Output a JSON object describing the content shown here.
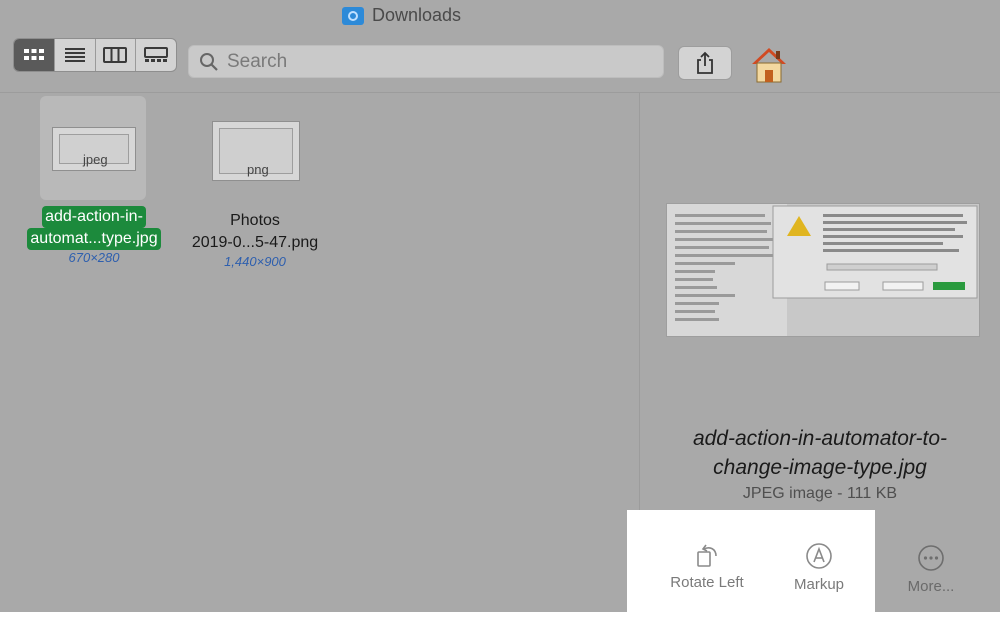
{
  "window": {
    "title": "Downloads"
  },
  "toolbar": {
    "view_modes": [
      "icon-view",
      "list-view",
      "column-view",
      "gallery-view"
    ],
    "active_view": "icon-view",
    "search_placeholder": "Search"
  },
  "files": [
    {
      "name": "add-action-in-automat...type.jpg",
      "name_line1": "add-action-in-",
      "name_line2": "automat...type.jpg",
      "badge": "jpeg",
      "dims": "670×280",
      "selected": true
    },
    {
      "name": "Photos 2019-0...5-47.png",
      "name_line1": "Photos",
      "name_line2": "2019-0...5-47.png",
      "badge": "png",
      "dims": "1,440×900",
      "selected": false
    }
  ],
  "preview": {
    "filename_line1": "add-action-in-automator-to-",
    "filename_line2": "change-image-type.jpg",
    "info": "JPEG image - 111 KB"
  },
  "actions": {
    "rotate_left": "Rotate Left",
    "markup": "Markup",
    "more": "More..."
  },
  "colors": {
    "selection": "#1c8a3c",
    "dims": "#2e5fae",
    "window_bg": "#a9a9a9"
  }
}
